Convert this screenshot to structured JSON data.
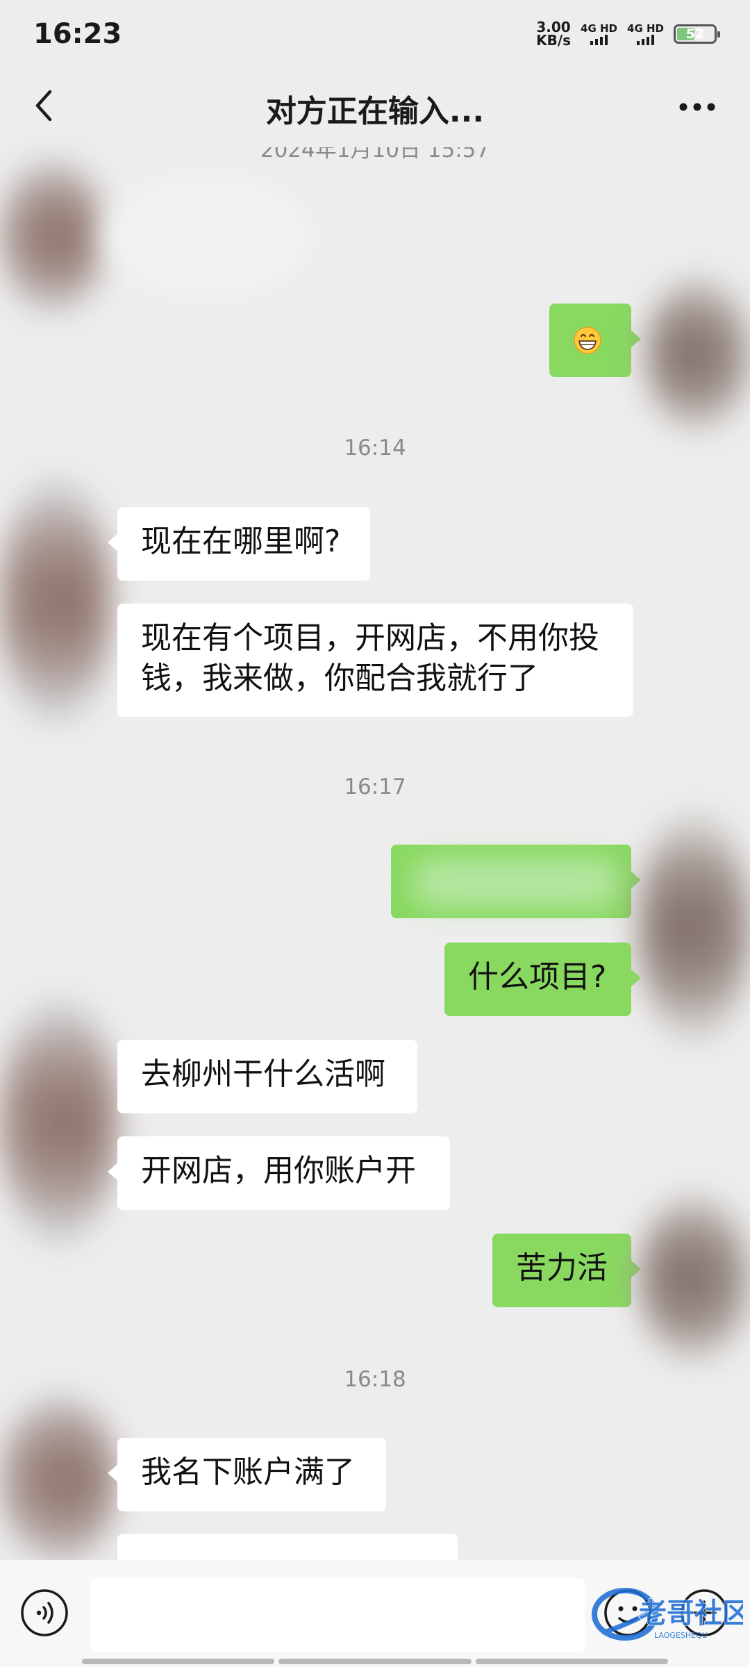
{
  "status_bar": {
    "time": "16:23",
    "speed_value": "3.00",
    "speed_unit": "KB/s",
    "network_1": "4G HD",
    "network_2": "4G HD",
    "battery": "52",
    "battery_percent": 52
  },
  "header": {
    "title": "对方正在输入...",
    "back_icon": "chevron-left-icon",
    "more_icon": "more-dots-icon"
  },
  "messages": {
    "ts_partial": "2024年1月10日 15:57",
    "ts_1": "16:14",
    "ts_2": "16:17",
    "ts_3": "16:18",
    "in_1": "现在在哪里啊?",
    "in_2_line1": "现在有个项目，开网店，不用你投",
    "in_2_line2": "钱，我来做，你配合我就行了",
    "out_what_project": "什么项目?",
    "in_3": "去柳州干什么活啊",
    "in_4": "开网店，用你账户开",
    "out_hard_work": "苦力活",
    "in_5": "我名下账户满了",
    "out_emoji_icon": "grinning-face-icon"
  },
  "input_bar": {
    "value": "",
    "voice_icon": "voice-icon",
    "emoji_icon": "emoji-smile-icon",
    "plus_icon": "plus-circle-icon"
  },
  "watermark": {
    "text": "老哥社区",
    "subtext": "LAOGESHEQU"
  },
  "colors": {
    "background": "#ededed",
    "outgoing_bubble": "#89d961",
    "incoming_bubble": "#ffffff",
    "timestamp": "#8a8a8a",
    "watermark": "#1f6fd6"
  }
}
